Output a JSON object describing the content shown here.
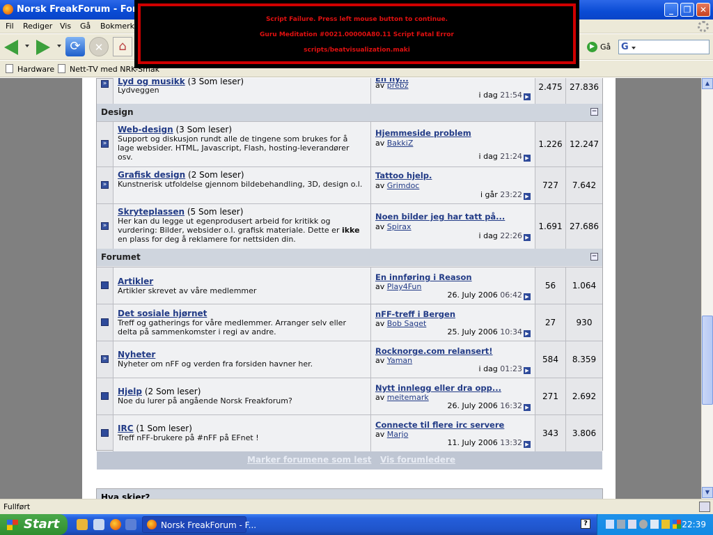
{
  "window": {
    "title": "Norsk FreakForum - Forumi"
  },
  "menu": {
    "items": [
      "Fil",
      "Rediger",
      "Vis",
      "Gå",
      "Bokmerker"
    ]
  },
  "nav": {
    "go_label": "Gå",
    "search_placeholder": ""
  },
  "bookmarks": [
    "Hardware",
    "Nett-TV med NRK-Smak"
  ],
  "guru": {
    "line1": "Script Failure.   Press left mouse button to continue.",
    "line2": "Guru Meditation #0021.00000A80.11  Script Fatal Error",
    "line3": "scripts/beatvisualization.maki"
  },
  "forum": {
    "top_row": {
      "name": "Lyd og musikk",
      "readers": "(3 Som leser)",
      "desc": "Lydveggen",
      "last_title": "En ny...",
      "last_by_prefix": "av",
      "last_by": "prebz",
      "last_date": "i dag",
      "last_time": "21:54",
      "topics": "2.475",
      "posts": "27.836"
    },
    "categories": [
      {
        "name": "Design",
        "collapse": "−",
        "forums": [
          {
            "name": "Web-design",
            "readers": "(3 Som leser)",
            "desc": "Support og diskusjon rundt alle de tingene som brukes for å lage websider. HTML, Javascript, Flash, hosting-leverandører osv.",
            "last_title": "Hjemmeside problem",
            "last_by": "BakkiZ",
            "last_date": "i dag",
            "last_time": "21:24",
            "topics": "1.226",
            "posts": "12.247"
          },
          {
            "name": "Grafisk design",
            "readers": "(2 Som leser)",
            "desc": "Kunstnerisk utfoldelse gjennom bildebehandling, 3D, design o.l.",
            "last_title": "Tattoo hjelp.",
            "last_by": "Grimdoc",
            "last_date": "i går",
            "last_time": "23:22",
            "topics": "727",
            "posts": "7.642"
          },
          {
            "name": "Skryteplassen",
            "readers": "(5 Som leser)",
            "desc": "Her kan du legge ut egenprodusert arbeid for kritikk og vurdering: Bilder, websider o.l. grafisk materiale. Dette er",
            "desc_bold": "ikke",
            "desc_tail": " en plass for deg å reklamere for nettsiden din.",
            "last_title": "Noen bilder jeg har tatt på...",
            "last_by": "Spirax",
            "last_date": "i dag",
            "last_time": "22:26",
            "topics": "1.691",
            "posts": "27.686"
          }
        ]
      },
      {
        "name": "Forumet",
        "collapse": "−",
        "forums": [
          {
            "name": "Artikler",
            "readers": "",
            "desc": "Artikler skrevet av våre medlemmer",
            "last_title": "En innføring i Reason",
            "last_by": "Play4Fun",
            "last_date": "26. July 2006",
            "last_time": "06:42",
            "topics": "56",
            "posts": "1.064"
          },
          {
            "name": "Det sosiale hjørnet",
            "readers": "",
            "desc": "Treff og gatherings for våre medlemmer. Arranger selv eller delta på sammenkomster i regi av andre.",
            "last_title": "nFF-treff i Bergen",
            "last_by": "Bob Saget",
            "last_date": "25. July 2006",
            "last_time": "10:34",
            "topics": "27",
            "posts": "930"
          },
          {
            "name": "Nyheter",
            "readers": "",
            "desc": "Nyheter om nFF og verden fra forsiden havner her.",
            "last_title": "Rocknorge.com relansert!",
            "last_by": "Yaman",
            "last_date": "i dag",
            "last_time": "01:23",
            "topics": "584",
            "posts": "8.359"
          },
          {
            "name": "Hjelp",
            "readers": "(2 Som leser)",
            "desc": "Noe du lurer på angående Norsk Freakforum?",
            "last_title": "Nytt innlegg eller dra opp...",
            "last_by": "meitemark",
            "last_date": "26. July 2006",
            "last_time": "16:32",
            "topics": "271",
            "posts": "2.692"
          },
          {
            "name": "IRC",
            "readers": "(1 Som leser)",
            "desc": "Treff nFF-brukere på #nFF på EFnet !",
            "last_title": "Connecte til flere irc servere",
            "last_by": "Marjo",
            "last_date": "11. July 2006",
            "last_time": "13:32",
            "topics": "343",
            "posts": "3.806"
          }
        ]
      }
    ],
    "by_prefix": "av",
    "footer": {
      "mark_read": "Marker forumene som lest",
      "leaders": "Vis forumledere"
    },
    "next_section": "Hva skjer?"
  },
  "status": {
    "text": "Fullført"
  },
  "taskbar": {
    "start": "Start",
    "task_label": "Norsk FreakForum - F...",
    "help": "?",
    "clock": "22:39"
  }
}
